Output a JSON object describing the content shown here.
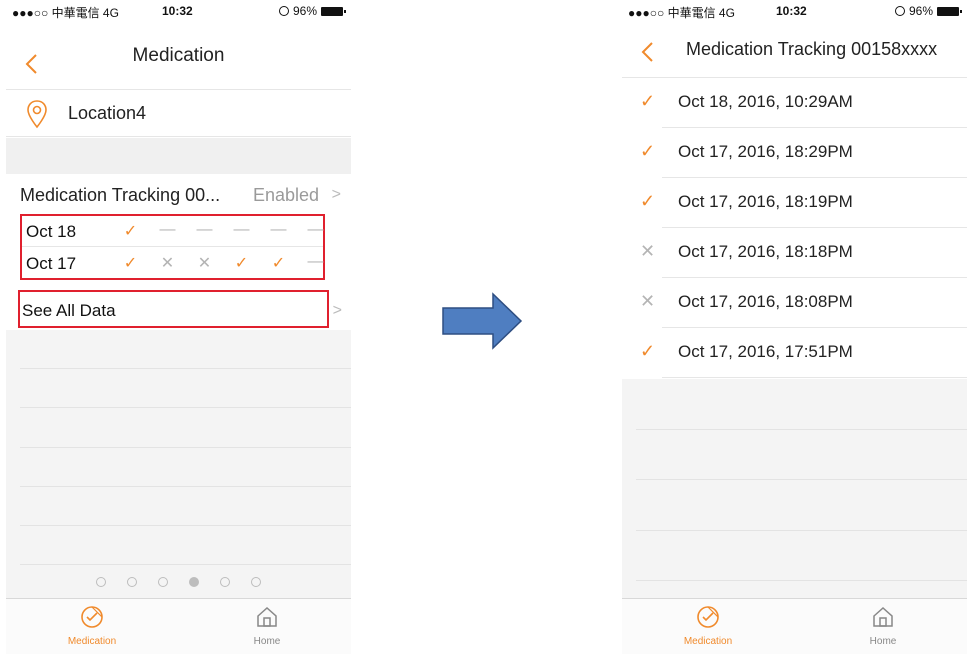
{
  "colors": {
    "accent": "#f08a2c",
    "highlight_border": "#e0202e",
    "arrow_fill": "#4f7ec1",
    "arrow_stroke": "#2e4e82"
  },
  "left": {
    "status": {
      "carrier": "●●●○○ 中華電信  4G",
      "time": "10:32",
      "battery": "96%"
    },
    "nav": {
      "title": "Medication"
    },
    "location": {
      "label": "Location4",
      "icon": "location-pin-icon"
    },
    "tracking": {
      "label": "Medication Tracking 00...",
      "status": "Enabled"
    },
    "days": [
      {
        "label": "Oct  18",
        "marks": [
          "✓",
          "—",
          "—",
          "—",
          "—",
          "—"
        ]
      },
      {
        "label": "Oct  17",
        "marks": [
          "✓",
          "✕",
          "✕",
          "✓",
          "✓",
          "—"
        ]
      }
    ],
    "see_all": {
      "label": "See All Data"
    },
    "page_dots": {
      "count": 6,
      "active": 4
    },
    "tabs": [
      {
        "label": "Medication",
        "icon": "medication-icon",
        "active": true
      },
      {
        "label": "Home",
        "icon": "home-icon",
        "active": false
      }
    ]
  },
  "right": {
    "status": {
      "carrier": "●●●○○ 中華電信  4G",
      "time": "10:32",
      "battery": "96%"
    },
    "nav": {
      "title": "Medication Tracking 00158xxxx"
    },
    "records": [
      {
        "icon": "check",
        "label": "Oct 18, 2016, 10:29AM"
      },
      {
        "icon": "check",
        "label": "Oct 17, 2016, 18:29PM"
      },
      {
        "icon": "check",
        "label": "Oct 17, 2016, 18:19PM"
      },
      {
        "icon": "cross",
        "label": "Oct 17, 2016, 18:18PM"
      },
      {
        "icon": "cross",
        "label": "Oct 17, 2016, 18:08PM"
      },
      {
        "icon": "check",
        "label": "Oct 17, 2016, 17:51PM"
      }
    ],
    "tabs": [
      {
        "label": "Medication",
        "icon": "medication-icon",
        "active": true
      },
      {
        "label": "Home",
        "icon": "home-icon",
        "active": false
      }
    ]
  }
}
